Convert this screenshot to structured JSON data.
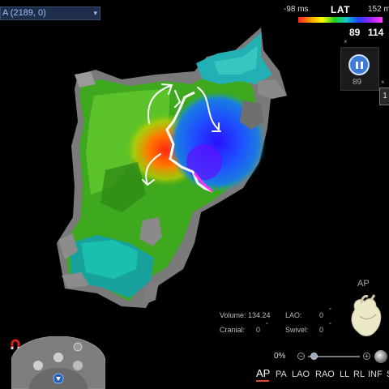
{
  "map_selector": {
    "label": "A (2189, 0)",
    "icon": "chevron-down-icon"
  },
  "color_scale": {
    "min_label": "-98 ms",
    "title": "LAT",
    "max_label": "152 m",
    "value_a": "89",
    "value_b": "114",
    "colors": [
      "#ff2020",
      "#ff9a00",
      "#ffff00",
      "#20d020",
      "#10c8c8",
      "#2040ff",
      "#a020ff",
      "#ff40ff"
    ]
  },
  "playback": {
    "count": "89",
    "close": "×",
    "side_tab": "1"
  },
  "view_info": {
    "volume_label": "Volume:",
    "volume_value": "134.24",
    "lao_label": "LAO:",
    "lao_value": "0",
    "cranial_label": "Cranial:",
    "cranial_value": "0",
    "swivel_label": "Swivel:",
    "swivel_value": "0",
    "degree": "°"
  },
  "orientation": {
    "label": "AP"
  },
  "zoom": {
    "value": "0%",
    "minus": "−",
    "plus": "+"
  },
  "view_buttons": [
    "AP",
    "PA",
    "LAO",
    "RAO",
    "LL",
    "RL",
    "INF",
    "S"
  ],
  "icons": {
    "magnet": "magnet-icon",
    "nav": "navigation-wheel-icon",
    "pause": "pause-icon"
  }
}
